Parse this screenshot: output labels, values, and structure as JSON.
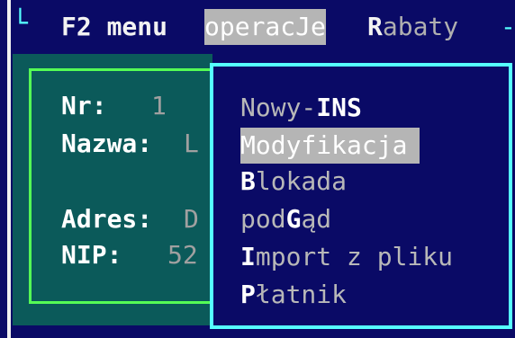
{
  "menubar": {
    "corner_glyph": "└",
    "f2_label": "F2 menu",
    "operacje": {
      "label": "operacJe"
    },
    "rabaty": {
      "hot": "R",
      "rest": "abaty"
    },
    "tail": "-"
  },
  "form": {
    "fields": [
      {
        "label": "Nr:",
        "value": "1"
      },
      {
        "label": "Nazwa:",
        "value": "L"
      },
      {
        "label": "Adres:",
        "value": "D"
      },
      {
        "label": "NIP:",
        "value": "52"
      }
    ]
  },
  "popup_menu": {
    "items": [
      {
        "pre": "Nowy-",
        "hot": "INS",
        "post": ""
      },
      {
        "pre": "Modyfikacja",
        "hot": "",
        "post": ""
      },
      {
        "pre": "",
        "hot": "B",
        "post": "lokada"
      },
      {
        "pre": "pod",
        "hot": "G",
        "post": "ąd"
      },
      {
        "pre": "",
        "hot": "I",
        "post": "mport z pliku"
      },
      {
        "pre": "",
        "hot": "P",
        "post": "łatnik"
      }
    ],
    "selected_index": 1
  },
  "colors": {
    "background": "#0a0a66",
    "border_cyan": "#55ffff",
    "form_bg": "#0b5a5a",
    "form_border": "#55ff55",
    "highlight": "#b5b5b5"
  }
}
